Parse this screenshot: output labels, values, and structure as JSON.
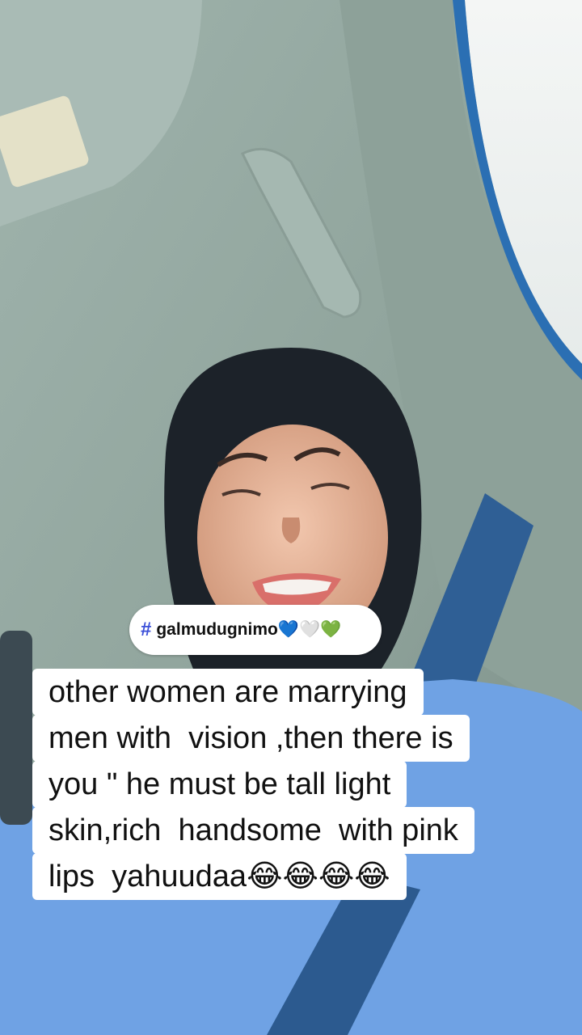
{
  "hashtag": {
    "icon": "hash-icon",
    "text": "galmudugnimo💙🤍💚"
  },
  "caption": {
    "lines": [
      "other women are marrying",
      "men with  vision ,then there is",
      "you \" he must be tall light",
      "skin,rich  handsome  with pink",
      "lips  yahuudaa😂😂😂😂"
    ]
  },
  "colors": {
    "accent": "#3b4fd8",
    "caption_bg": "#ffffff"
  }
}
